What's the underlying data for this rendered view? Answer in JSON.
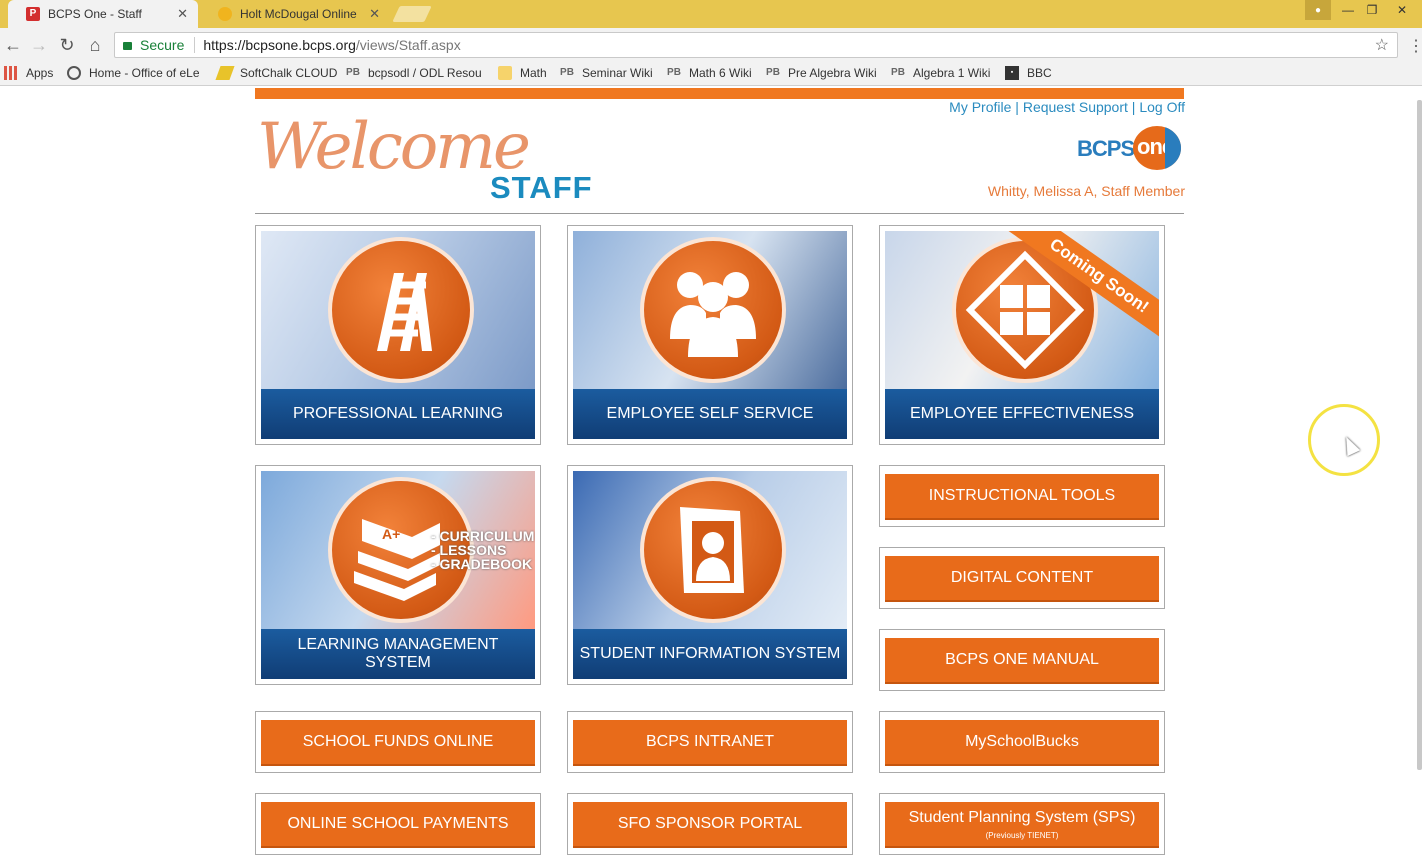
{
  "browser": {
    "tabs": [
      {
        "title": "BCPS One - Staff",
        "active": true
      },
      {
        "title": "Holt McDougal Online",
        "active": false
      }
    ],
    "close_glyph": "✕",
    "secure_label": "Secure",
    "url_host": "https://bcpsone.bcps.org",
    "url_path": "/views/Staff.aspx",
    "bookmarks": [
      {
        "label": "Apps",
        "icon": "apps-icon"
      },
      {
        "label": "Home - Office of eLe",
        "icon": "globe-icon"
      },
      {
        "label": "SoftChalk CLOUD",
        "icon": "softchalk-icon"
      },
      {
        "label": "bcpsodl / ODL Resou",
        "icon": "pb-icon",
        "badge": "PB"
      },
      {
        "label": "Math",
        "icon": "folder-icon"
      },
      {
        "label": "Seminar Wiki",
        "icon": "pb-icon",
        "badge": "PB"
      },
      {
        "label": "Math 6 Wiki",
        "icon": "pb-icon",
        "badge": "PB"
      },
      {
        "label": "Pre Algebra Wiki",
        "icon": "pb-icon",
        "badge": "PB"
      },
      {
        "label": "Algebra 1 Wiki",
        "icon": "pb-icon",
        "badge": "PB"
      },
      {
        "label": "BBC",
        "icon": "bbc-icon"
      }
    ]
  },
  "header": {
    "links": [
      "My Profile",
      "Request Support",
      "Log Off"
    ],
    "link_separator": " | ",
    "welcome": "Welcome",
    "staff": "STAFF",
    "logo_bcps": "BCPS",
    "logo_one": "one",
    "user": "Whitty, Melissa A, Staff Member"
  },
  "tiles": [
    {
      "label": "PROFESSIONAL LEARNING",
      "icon": "ladder-icon"
    },
    {
      "label": "EMPLOYEE SELF SERVICE",
      "icon": "people-icon"
    },
    {
      "label": "EMPLOYEE EFFECTIVENESS",
      "icon": "arrows-icon",
      "ribbon": "Coming Soon!"
    },
    {
      "label": "LEARNING MANAGEMENT SYSTEM",
      "icon": "books-icon",
      "list": [
        "- CURRICULUM",
        "- LESSONS",
        "- GRADEBOOK"
      ],
      "book_text": "A+"
    },
    {
      "label": "STUDENT INFORMATION SYSTEM",
      "icon": "student-icon"
    }
  ],
  "buttons": {
    "instructional_tools": "INSTRUCTIONAL TOOLS",
    "digital_content": "DIGITAL CONTENT",
    "bcps_one_manual": "BCPS ONE MANUAL",
    "school_funds": "SCHOOL FUNDS ONLINE",
    "bcps_intranet": "BCPS INTRANET",
    "myschoolbucks": "MySchoolBucks",
    "online_payments": "ONLINE SCHOOL PAYMENTS",
    "sfo_portal": "SFO SPONSOR PORTAL",
    "sps": "Student Planning System (SPS)",
    "sps_sub": "(Previously TIENET)"
  },
  "colors": {
    "accent_orange": "#e86b1a",
    "brand_blue": "#1b8bbf",
    "caption_blue": "#1b5c9f"
  }
}
